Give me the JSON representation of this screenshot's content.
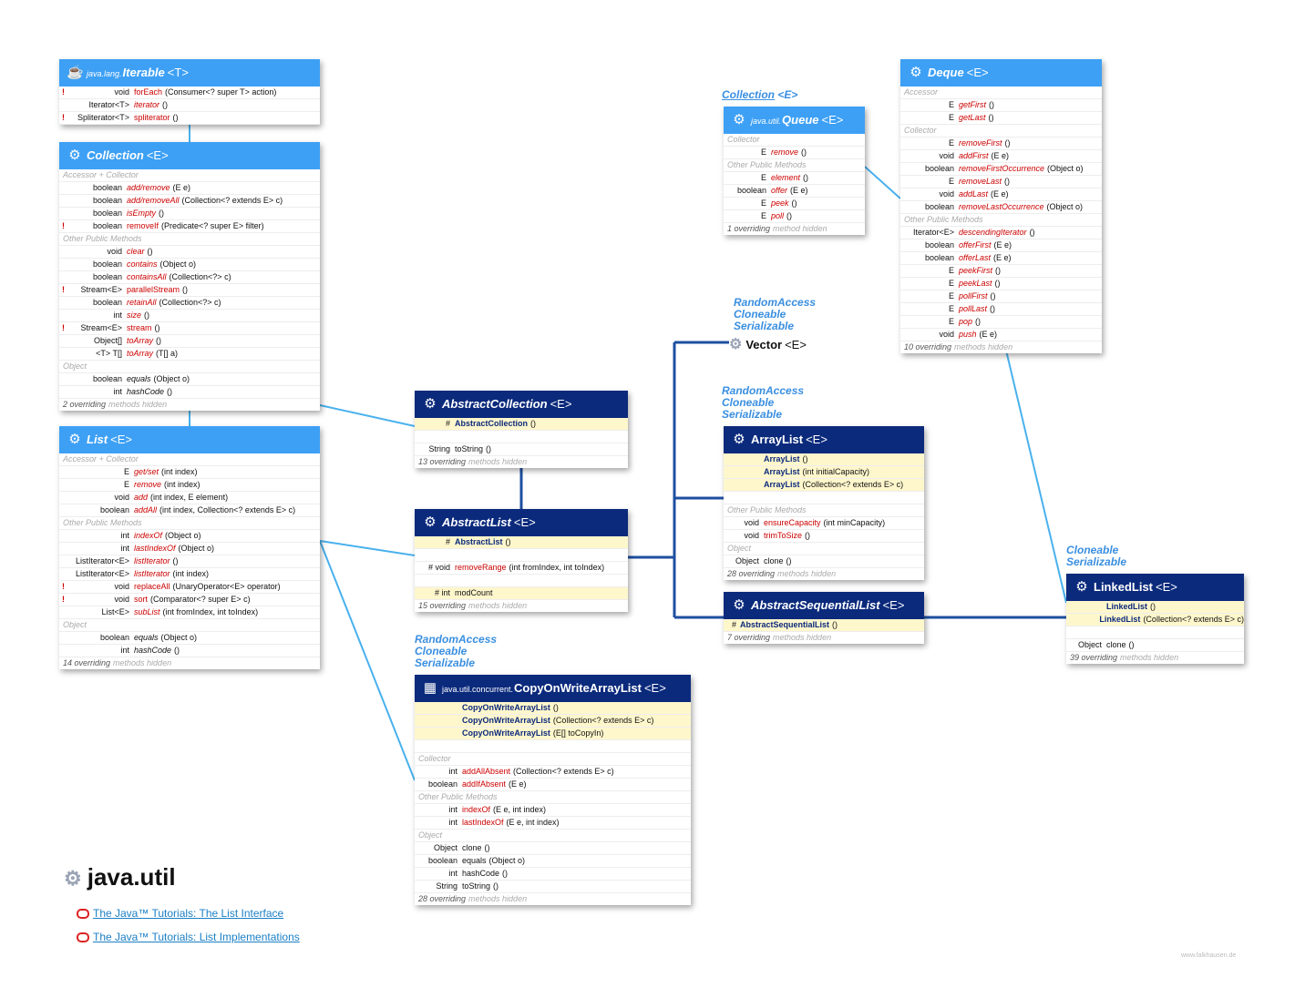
{
  "package": {
    "title": "java.util",
    "icon": "gear-icon"
  },
  "links": [
    {
      "text": "The Java™ Tutorials: The List Interface",
      "icon": "oracle-icon"
    },
    {
      "text": "The Java™ Tutorials: List Implementations",
      "icon": "oracle-icon"
    }
  ],
  "watermark": "www.falkhausen.de",
  "colors": {
    "interface_header": "#3da0f5",
    "class_header": "#0b2a7c",
    "annotation": "#3a8fe0",
    "method": "#cc0000",
    "highlight": "#fff7cc"
  },
  "annotations": {
    "collection_queue": "Collection",
    "collection_queue_tp": "<E>",
    "vector_ifaces": [
      "RandomAccess",
      "Cloneable",
      "Serializable"
    ],
    "arraylist_ifaces": [
      "RandomAccess",
      "Cloneable",
      "Serializable"
    ],
    "linkedlist_ifaces": [
      "Cloneable",
      "Serializable"
    ],
    "cow_ifaces": [
      "RandomAccess",
      "Cloneable",
      "Serializable"
    ]
  },
  "vector": {
    "name": "Vector",
    "tp": "<E>"
  },
  "boxes": {
    "iterable": {
      "pkg": "java.lang.",
      "name": "Iterable",
      "tp": "<T>",
      "rows": [
        {
          "kind": "row",
          "ex": "!",
          "ty": "void",
          "me": "forEach",
          "pa": "(Consumer<? super T> action)"
        },
        {
          "kind": "row",
          "ty": "Iterator<T>",
          "me": "iterator",
          "pa": "()",
          "it": true
        },
        {
          "kind": "row",
          "ex": "!",
          "ty": "Spliterator<T>",
          "me": "spliterator",
          "pa": "()"
        }
      ]
    },
    "collection": {
      "name": "Collection",
      "tp": "<E>",
      "rows": [
        {
          "kind": "sec",
          "text": "Accessor + Collector"
        },
        {
          "kind": "row",
          "ty": "boolean",
          "me": "add/remove",
          "pa": "(E e)",
          "it": true
        },
        {
          "kind": "row",
          "ty": "boolean",
          "me": "add/removeAll",
          "pa": "(Collection<? extends E> c)",
          "it": true
        },
        {
          "kind": "row",
          "ty": "boolean",
          "me": "isEmpty",
          "pa": "()",
          "it": true
        },
        {
          "kind": "row",
          "ex": "!",
          "ty": "boolean",
          "me": "removeIf",
          "pa": "(Predicate<? super E> filter)"
        },
        {
          "kind": "sec",
          "text": "Other Public Methods"
        },
        {
          "kind": "row",
          "ty": "void",
          "me": "clear",
          "pa": "()",
          "it": true
        },
        {
          "kind": "row",
          "ty": "boolean",
          "me": "contains",
          "pa": "(Object o)",
          "it": true
        },
        {
          "kind": "row",
          "ty": "boolean",
          "me": "containsAll",
          "pa": "(Collection<?> c)",
          "it": true
        },
        {
          "kind": "row",
          "ex": "!",
          "ty": "Stream<E>",
          "me": "parallelStream",
          "pa": "()"
        },
        {
          "kind": "row",
          "ty": "boolean",
          "me": "retainAll",
          "pa": "(Collection<?> c)",
          "it": true
        },
        {
          "kind": "row",
          "ty": "int",
          "me": "size",
          "pa": "()",
          "it": true
        },
        {
          "kind": "row",
          "ex": "!",
          "ty": "Stream<E>",
          "me": "stream",
          "pa": "()"
        },
        {
          "kind": "row",
          "ty": "Object[]",
          "me": "toArray",
          "pa": "()",
          "it": true
        },
        {
          "kind": "row",
          "ty": "<T> T[]",
          "me": "toArray",
          "pa": "(T[] a)",
          "it": true
        },
        {
          "kind": "sec",
          "text": "Object"
        },
        {
          "kind": "row",
          "ty": "boolean",
          "me": "equals",
          "pa": "(Object o)",
          "it": true,
          "blk": true
        },
        {
          "kind": "row",
          "ty": "int",
          "me": "hashCode",
          "pa": "()",
          "it": true,
          "blk": true
        },
        {
          "kind": "foot",
          "count": "2 overriding",
          "hid": "methods hidden"
        }
      ]
    },
    "list": {
      "name": "List",
      "tp": "<E>",
      "rows": [
        {
          "kind": "sec",
          "text": "Accessor + Collector"
        },
        {
          "kind": "row",
          "ty": "E",
          "me": "get/set",
          "pa": "(int index)",
          "it": true
        },
        {
          "kind": "row",
          "ty": "E",
          "me": "remove",
          "pa": "(int index)",
          "it": true
        },
        {
          "kind": "row",
          "ty": "void",
          "me": "add",
          "pa": "(int index, E element)",
          "it": true
        },
        {
          "kind": "row",
          "ty": "boolean",
          "me": "addAll",
          "pa": "(int index, Collection<? extends E> c)",
          "it": true
        },
        {
          "kind": "sec",
          "text": "Other Public Methods"
        },
        {
          "kind": "row",
          "ty": "int",
          "me": "indexOf",
          "pa": "(Object o)",
          "it": true
        },
        {
          "kind": "row",
          "ty": "int",
          "me": "lastIndexOf",
          "pa": "(Object o)",
          "it": true
        },
        {
          "kind": "row",
          "ty": "ListIterator<E>",
          "me": "listIterator",
          "pa": "()",
          "it": true
        },
        {
          "kind": "row",
          "ty": "ListIterator<E>",
          "me": "listIterator",
          "pa": "(int index)",
          "it": true
        },
        {
          "kind": "row",
          "ex": "!",
          "ty": "void",
          "me": "replaceAll",
          "pa": "(UnaryOperator<E> operator)"
        },
        {
          "kind": "row",
          "ex": "!",
          "ty": "void",
          "me": "sort",
          "pa": "(Comparator<? super E> c)"
        },
        {
          "kind": "row",
          "ty": "List<E>",
          "me": "subList",
          "pa": "(int fromIndex, int toIndex)",
          "it": true
        },
        {
          "kind": "sec",
          "text": "Object"
        },
        {
          "kind": "row",
          "ty": "boolean",
          "me": "equals",
          "pa": "(Object o)",
          "it": true,
          "blk": true
        },
        {
          "kind": "row",
          "ty": "int",
          "me": "hashCode",
          "pa": "()",
          "it": true,
          "blk": true
        },
        {
          "kind": "foot",
          "count": "14 overriding",
          "hid": "methods hidden"
        }
      ]
    },
    "abstractcollection": {
      "name": "AbstractCollection",
      "tp": "<E>",
      "rows": [
        {
          "kind": "row",
          "hl": true,
          "ty": "#",
          "me": "AbstractCollection",
          "pa": "()",
          "blu": true
        },
        {
          "kind": "gap"
        },
        {
          "kind": "row",
          "ty": "String",
          "me": "toString",
          "pa": "()",
          "blk": true
        },
        {
          "kind": "foot",
          "count": "13 overriding",
          "hid": "methods hidden"
        }
      ]
    },
    "abstractlist": {
      "name": "AbstractList",
      "tp": "<E>",
      "rows": [
        {
          "kind": "row",
          "hl": true,
          "ty": "#",
          "me": "AbstractList",
          "pa": "()",
          "blu": true
        },
        {
          "kind": "gap"
        },
        {
          "kind": "row",
          "ty": "# void",
          "me": "removeRange",
          "pa": "(int fromIndex, int toIndex)"
        },
        {
          "kind": "gap"
        },
        {
          "kind": "row",
          "hl": true,
          "ty": "# int",
          "me": "modCount",
          "pa": "",
          "blk": true
        },
        {
          "kind": "foot",
          "count": "15 overriding",
          "hid": "methods hidden"
        }
      ]
    },
    "cow": {
      "pkg": "java.util.concurrent.",
      "name": "CopyOnWriteArrayList",
      "tp": "<E>",
      "rows": [
        {
          "kind": "row",
          "hl": true,
          "ty": "",
          "me": "CopyOnWriteArrayList",
          "pa": "()",
          "blu": true
        },
        {
          "kind": "row",
          "hl": true,
          "ty": "",
          "me": "CopyOnWriteArrayList",
          "pa": "(Collection<? extends E> c)",
          "blu": true
        },
        {
          "kind": "row",
          "hl": true,
          "ty": "",
          "me": "CopyOnWriteArrayList",
          "pa": "(E[] toCopyIn)",
          "blu": true
        },
        {
          "kind": "gap"
        },
        {
          "kind": "sec",
          "text": "Collector"
        },
        {
          "kind": "row",
          "ty": "int",
          "me": "addAllAbsent",
          "pa": "(Collection<? extends E> c)"
        },
        {
          "kind": "row",
          "ty": "boolean",
          "me": "addIfAbsent",
          "pa": "(E e)"
        },
        {
          "kind": "sec",
          "text": "Other Public Methods"
        },
        {
          "kind": "row",
          "ty": "int",
          "me": "indexOf",
          "pa": "(E e, int index)"
        },
        {
          "kind": "row",
          "ty": "int",
          "me": "lastIndexOf",
          "pa": "(E e, int index)"
        },
        {
          "kind": "sec",
          "text": "Object"
        },
        {
          "kind": "row",
          "ty": "Object",
          "me": "clone",
          "pa": "()",
          "blk": true
        },
        {
          "kind": "row",
          "ty": "boolean",
          "me": "equals",
          "pa": "(Object o)",
          "blk": true
        },
        {
          "kind": "row",
          "ty": "int",
          "me": "hashCode",
          "pa": "()",
          "blk": true
        },
        {
          "kind": "row",
          "ty": "String",
          "me": "toString",
          "pa": "()",
          "blk": true
        },
        {
          "kind": "foot",
          "count": "28 overriding",
          "hid": "methods hidden"
        }
      ]
    },
    "queue": {
      "pkg": "java.util.",
      "name": "Queue",
      "tp": "<E>",
      "rows": [
        {
          "kind": "sec",
          "text": "Collector"
        },
        {
          "kind": "row",
          "ty": "E",
          "me": "remove",
          "pa": "()",
          "it": true
        },
        {
          "kind": "sec",
          "text": "Other Public Methods"
        },
        {
          "kind": "row",
          "ty": "E",
          "me": "element",
          "pa": "()",
          "it": true
        },
        {
          "kind": "row",
          "ty": "boolean",
          "me": "offer",
          "pa": "(E e)",
          "it": true
        },
        {
          "kind": "row",
          "ty": "E",
          "me": "peek",
          "pa": "()",
          "it": true
        },
        {
          "kind": "row",
          "ty": "E",
          "me": "poll",
          "pa": "()",
          "it": true
        },
        {
          "kind": "foot",
          "count": "1 overriding",
          "hid": "method hidden"
        }
      ]
    },
    "deque": {
      "name": "Deque",
      "tp": "<E>",
      "rows": [
        {
          "kind": "sec",
          "text": "Accessor"
        },
        {
          "kind": "row",
          "ty": "E",
          "me": "getFirst",
          "pa": "()",
          "it": true
        },
        {
          "kind": "row",
          "ty": "E",
          "me": "getLast",
          "pa": "()",
          "it": true
        },
        {
          "kind": "sec",
          "text": "Collector"
        },
        {
          "kind": "row",
          "ty": "E",
          "me": "removeFirst",
          "pa": "()",
          "it": true
        },
        {
          "kind": "row",
          "ty": "void",
          "me": "addFirst",
          "pa": "(E e)",
          "it": true
        },
        {
          "kind": "row",
          "ty": "boolean",
          "me": "removeFirstOccurrence",
          "pa": "(Object o)",
          "it": true
        },
        {
          "kind": "row",
          "ty": "E",
          "me": "removeLast",
          "pa": "()",
          "it": true
        },
        {
          "kind": "row",
          "ty": "void",
          "me": "addLast",
          "pa": "(E e)",
          "it": true
        },
        {
          "kind": "row",
          "ty": "boolean",
          "me": "removeLastOccurrence",
          "pa": "(Object o)",
          "it": true
        },
        {
          "kind": "sec",
          "text": "Other Public Methods"
        },
        {
          "kind": "row",
          "ty": "Iterator<E>",
          "me": "descendingIterator",
          "pa": "()",
          "it": true
        },
        {
          "kind": "row",
          "ty": "boolean",
          "me": "offerFirst",
          "pa": "(E e)",
          "it": true
        },
        {
          "kind": "row",
          "ty": "boolean",
          "me": "offerLast",
          "pa": "(E e)",
          "it": true
        },
        {
          "kind": "row",
          "ty": "E",
          "me": "peekFirst",
          "pa": "()",
          "it": true
        },
        {
          "kind": "row",
          "ty": "E",
          "me": "peekLast",
          "pa": "()",
          "it": true
        },
        {
          "kind": "row",
          "ty": "E",
          "me": "pollFirst",
          "pa": "()",
          "it": true
        },
        {
          "kind": "row",
          "ty": "E",
          "me": "pollLast",
          "pa": "()",
          "it": true
        },
        {
          "kind": "row",
          "ty": "E",
          "me": "pop",
          "pa": "()",
          "it": true
        },
        {
          "kind": "row",
          "ty": "void",
          "me": "push",
          "pa": "(E e)",
          "it": true
        },
        {
          "kind": "foot",
          "count": "10 overriding",
          "hid": "methods hidden"
        }
      ]
    },
    "arraylist": {
      "name": "ArrayList",
      "tp": "<E>",
      "rows": [
        {
          "kind": "row",
          "hl": true,
          "ty": "",
          "me": "ArrayList",
          "pa": "()",
          "blu": true
        },
        {
          "kind": "row",
          "hl": true,
          "ty": "",
          "me": "ArrayList",
          "pa": "(int initialCapacity)",
          "blu": true
        },
        {
          "kind": "row",
          "hl": true,
          "ty": "",
          "me": "ArrayList",
          "pa": "(Collection<? extends E> c)",
          "blu": true
        },
        {
          "kind": "gap"
        },
        {
          "kind": "sec",
          "text": "Other Public Methods"
        },
        {
          "kind": "row",
          "ty": "void",
          "me": "ensureCapacity",
          "pa": "(int minCapacity)"
        },
        {
          "kind": "row",
          "ty": "void",
          "me": "trimToSize",
          "pa": "()"
        },
        {
          "kind": "sec",
          "text": "Object"
        },
        {
          "kind": "row",
          "ty": "Object",
          "me": "clone",
          "pa": "()",
          "blk": true
        },
        {
          "kind": "foot",
          "count": "28 overriding",
          "hid": "methods hidden"
        }
      ]
    },
    "abstractsequentiallist": {
      "name": "AbstractSequentialList",
      "tp": "<E>",
      "rows": [
        {
          "kind": "row",
          "hl": true,
          "ty": "#",
          "me": "AbstractSequentialList",
          "pa": "()",
          "blu": true
        },
        {
          "kind": "foot",
          "count": "7 overriding",
          "hid": "methods hidden"
        }
      ]
    },
    "linkedlist": {
      "name": "LinkedList",
      "tp": "<E>",
      "rows": [
        {
          "kind": "row",
          "hl": true,
          "ty": "",
          "me": "LinkedList",
          "pa": "()",
          "blu": true
        },
        {
          "kind": "row",
          "hl": true,
          "ty": "",
          "me": "LinkedList",
          "pa": "(Collection<? extends E> c)",
          "blu": true
        },
        {
          "kind": "gap"
        },
        {
          "kind": "row",
          "ty": "Object",
          "me": "clone",
          "pa": "()",
          "blk": true
        },
        {
          "kind": "foot",
          "count": "39 overriding",
          "hid": "methods hidden"
        }
      ]
    }
  }
}
